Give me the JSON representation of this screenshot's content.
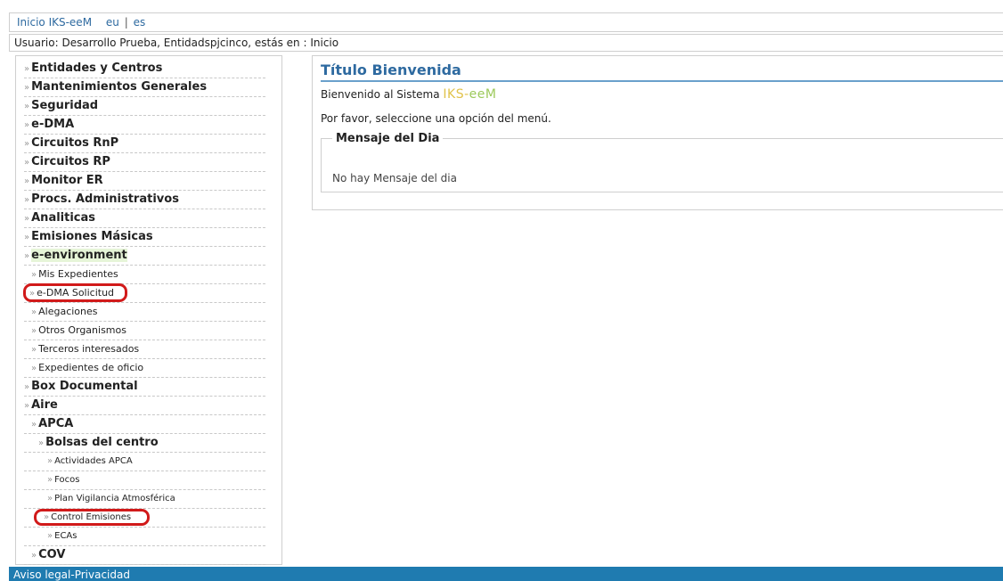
{
  "topbar": {
    "home_link": "Inicio IKS-eeM",
    "lang_eu": "eu",
    "lang_sep": "|",
    "lang_es": "es"
  },
  "userbar": {
    "text": "Usuario: Desarrollo Prueba, Entidadspjcinco, estás en : Inicio"
  },
  "sidebar": {
    "items": [
      {
        "label": "Entidades y Centros"
      },
      {
        "label": "Mantenimientos Generales"
      },
      {
        "label": "Seguridad"
      },
      {
        "label": "e-DMA"
      },
      {
        "label": "Circuitos RnP"
      },
      {
        "label": "Circuitos RP"
      },
      {
        "label": "Monitor ER"
      },
      {
        "label": "Procs. Administrativos"
      },
      {
        "label": "Analiticas"
      },
      {
        "label": "Emisiones Másicas"
      },
      {
        "label": "e-environment"
      },
      {
        "label": "Mis Expedientes"
      },
      {
        "label": "e-DMA Solicitud"
      },
      {
        "label": "Alegaciones"
      },
      {
        "label": "Otros Organismos"
      },
      {
        "label": "Terceros interesados"
      },
      {
        "label": "Expedientes de oficio"
      },
      {
        "label": "Box Documental"
      },
      {
        "label": "Aire"
      },
      {
        "label": "APCA"
      },
      {
        "label": "Bolsas del centro"
      },
      {
        "label": "Actividades APCA"
      },
      {
        "label": "Focos"
      },
      {
        "label": "Plan Vigilancia Atmosférica"
      },
      {
        "label": "Control Emisiones"
      },
      {
        "label": "ECAs"
      },
      {
        "label": "COV"
      }
    ],
    "arrow": "»"
  },
  "content": {
    "title": "Título Bienvenida",
    "welcome_prefix": "Bienvenido al Sistema",
    "brand_a": "IKS-",
    "brand_b": "eeM",
    "hint": "Por favor, seleccione una opción del menú.",
    "motd_legend": "Mensaje del Dia",
    "motd_text": "No hay Mensaje del dia"
  },
  "footer": {
    "text": "Aviso legal-Privacidad"
  },
  "colors": {
    "link": "#2e6aa0",
    "footer_bg": "#1f7bb0",
    "highlight_ring": "#d11a1a",
    "brand_yellow": "#e0c24a",
    "brand_green": "#9cc95b"
  }
}
